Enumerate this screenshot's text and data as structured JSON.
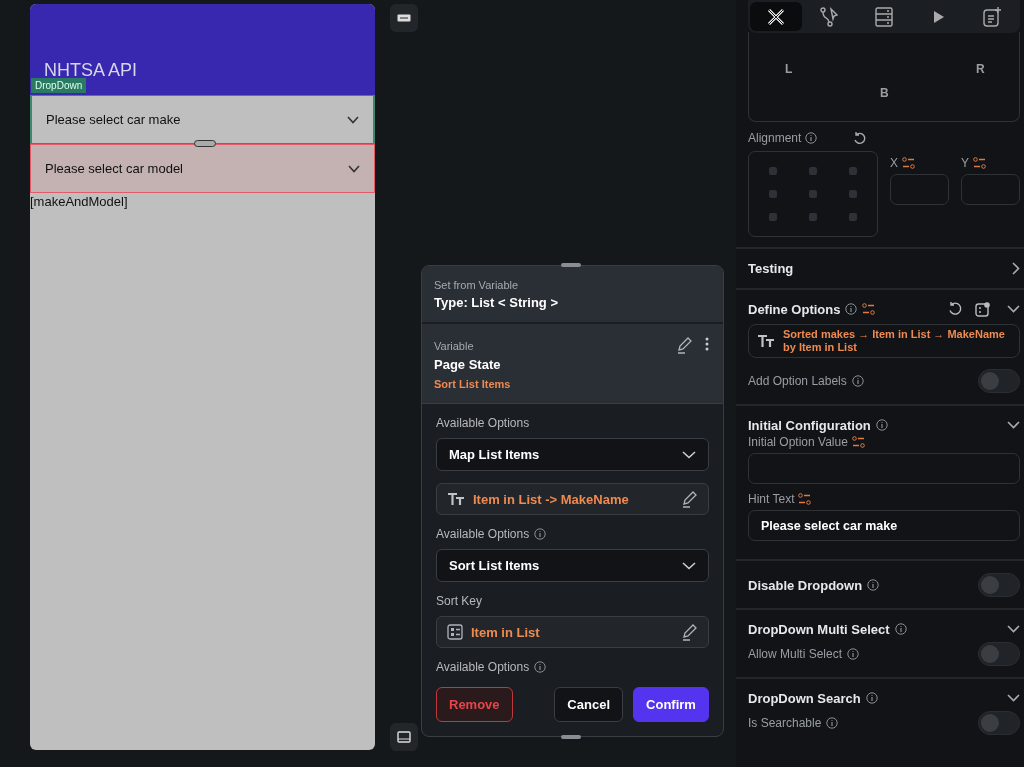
{
  "canvas": {
    "app_bar_title": "NHTSA API",
    "selection_tag": "DropDown",
    "dropdowns": [
      {
        "hint": "Please select car make",
        "selected": true,
        "highlighted": false
      },
      {
        "hint": "Please select car model",
        "selected": false,
        "highlighted": true
      }
    ],
    "text": "[makeAndModel]"
  },
  "popup": {
    "title": "Set from Variable",
    "type": "Type: List < String >",
    "variable": {
      "label": "Variable",
      "name": "Page State",
      "transform": "Sort List Items"
    },
    "steps": [
      {
        "kind": "select",
        "label": "Available Options",
        "info": false,
        "value": "Map List Items"
      },
      {
        "kind": "text_expression",
        "value": "Item in List -> MakeName"
      },
      {
        "kind": "select",
        "label": "Available Options",
        "info": true,
        "value": "Sort List Items"
      },
      {
        "kind": "list_expression",
        "label": "Sort Key",
        "info": false,
        "value": "Item in List"
      },
      {
        "kind": "label",
        "label": "Available Options",
        "info": true
      }
    ],
    "buttons": [
      {
        "label": "Remove",
        "kind": "danger"
      },
      {
        "label": "Cancel",
        "kind": "secondary"
      },
      {
        "label": "Confirm",
        "kind": "primary"
      }
    ]
  },
  "properties": {
    "tabs": [
      {
        "kind": "design",
        "selected": true
      },
      {
        "kind": "logic",
        "selected": false
      },
      {
        "kind": "data",
        "selected": false
      },
      {
        "kind": "run",
        "selected": false
      },
      {
        "kind": "notes",
        "selected": false
      }
    ],
    "padding": {
      "left": "L",
      "right": "R",
      "bottom": "B"
    },
    "alignment": {
      "label": "Alignment",
      "x_label": "X",
      "y_label": "Y"
    },
    "sections": [
      {
        "kind": "link",
        "title": "Testing"
      },
      {
        "kind": "group",
        "title": "Define Options",
        "info": true,
        "variable": true,
        "expanded": true,
        "rows": [
          {
            "kind": "expression",
            "value": "Sorted makes → Item in List → MakeName by Item in List"
          },
          {
            "kind": "toggle",
            "label": "Add Option Labels",
            "info": true,
            "on": false
          }
        ]
      },
      {
        "kind": "group",
        "title": "Initial Configuration",
        "info": true,
        "variable": false,
        "expanded": true,
        "rows": [
          {
            "kind": "field",
            "label": "Initial Option Value"
          },
          {
            "kind": "field",
            "label": "Hint Text",
            "value": "Please select car make"
          }
        ]
      },
      {
        "kind": "toggle",
        "label": "Disable Dropdown",
        "info": true,
        "on": false
      },
      {
        "kind": "group",
        "title": "DropDown Multi Select",
        "info": true,
        "variable": false,
        "expanded": true,
        "rows": [
          {
            "kind": "toggle",
            "label": "Allow Multi Select",
            "info": true,
            "on": false
          }
        ]
      },
      {
        "kind": "group",
        "title": "DropDown Search",
        "info": true,
        "variable": false,
        "expanded": true,
        "rows": [
          {
            "kind": "toggle",
            "label": "Is Searchable",
            "info": true,
            "on": false
          }
        ]
      }
    ]
  }
}
